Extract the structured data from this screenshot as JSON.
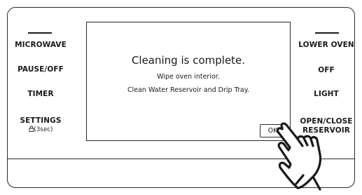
{
  "left_buttons": {
    "microwave": "MICROWAVE",
    "pause_off": "PAUSE/OFF",
    "timer": "TIMER",
    "settings": "SETTINGS",
    "settings_sub": "(3sec)"
  },
  "right_buttons": {
    "lower_oven": "LOWER OVEN",
    "off": "OFF",
    "light": "LIGHT",
    "open_close_line1": "OPEN/CLOSE",
    "open_close_line2": "RESERVOIR"
  },
  "dialog": {
    "title": "Cleaning is complete.",
    "line1": "Wipe oven interior.",
    "line2": "Clean Water Reservoir and Drip Tray.",
    "ok_label": "OK"
  },
  "icons": {
    "lock": "lock-icon",
    "hand": "pointing-hand-icon"
  }
}
